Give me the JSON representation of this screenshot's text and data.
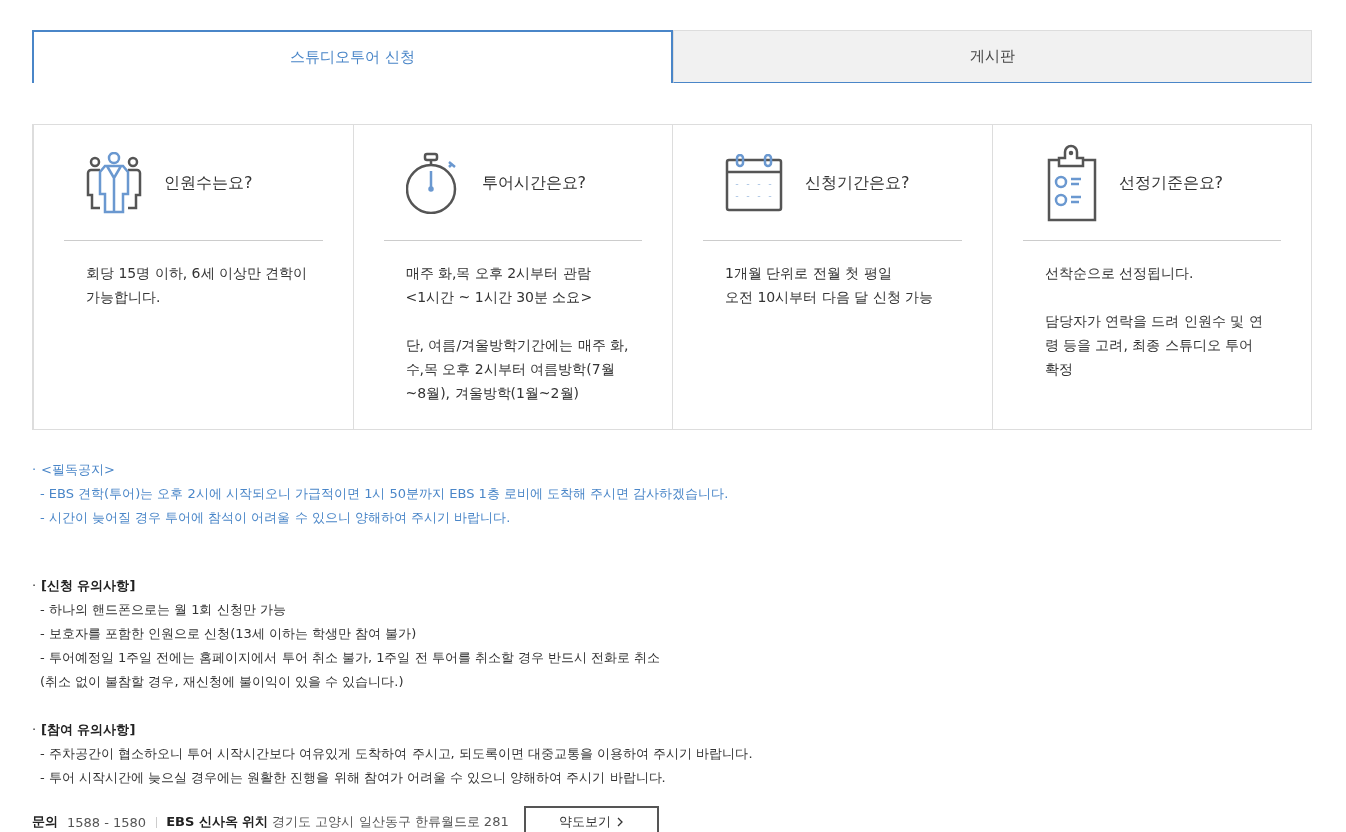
{
  "tabs": [
    {
      "label": "스튜디오투어 신청",
      "selected": true
    },
    {
      "label": "게시판",
      "selected": false
    }
  ],
  "cards": [
    {
      "kind": "people",
      "title": "인원수는요?",
      "paragraphs": [
        [
          "회당 15명 이하, 6세 이상만 견학이 가능합니다."
        ]
      ]
    },
    {
      "kind": "stopwatch",
      "title": "투어시간은요?",
      "paragraphs": [
        [
          "매주 화,목 오후 2시부터 관람",
          "<1시간 ~ 1시간 30분 소요>"
        ],
        [
          "단, 여름/겨울방학기간에는 매주 화,수,목 오후 2시부터 여름방학(7월~8월), 겨울방학(1월~2월)"
        ]
      ]
    },
    {
      "kind": "calendar",
      "title": "신청기간은요?",
      "paragraphs": [
        [
          "1개월 단위로 전월 첫 평일",
          "오전 10시부터 다음 달 신청 가능"
        ]
      ]
    },
    {
      "kind": "clipboard",
      "title": "선정기준은요?",
      "paragraphs": [
        [
          "선착순으로 선정됩니다."
        ],
        [
          "담당자가 연락을 드려 인원수 및 연령 등을 고려, 최종 스튜디오 투어 확정"
        ]
      ]
    }
  ],
  "notices": [
    {
      "kind": "notice",
      "bullet": "·",
      "heading": "<필독공지>",
      "lines": [
        "- EBS 견학(투어)는 오후 2시에 시작되오니 가급적이면 1시 50분까지 EBS 1층 로비에 도착해 주시면 감사하겠습니다.",
        "- 시간이 늦어질 경우 투어에 참석이 어려울 수 있으니 양해하여 주시기 바랍니다."
      ]
    },
    {
      "kind": "rule",
      "bullet": "·",
      "heading": "[신청 유의사항]",
      "lines": [
        "- 하나의 핸드폰으로는 월 1회 신청만 가능",
        "- 보호자를 포함한 인원으로 신청(13세 이하는 학생만 참여 불가)",
        "- 투어예정일 1주일 전에는 홈페이지에서 투어 취소 불가, 1주일 전 투어를 취소할 경우 반드시 전화로 취소",
        "(취소 없이 불참할 경우, 재신청에 불이익이 있을 수 있습니다.)"
      ]
    },
    {
      "kind": "rule",
      "bullet": "·",
      "heading": "[참여 유의사항]",
      "lines": [
        "- 주차공간이 협소하오니 투어 시작시간보다 여유있게 도착하여 주시고, 되도록이면 대중교통을 이용하여 주시기 바랍니다.",
        "- 투어 시작시간에 늦으실 경우에는 원활한 진행을 위해 참여가 어려울 수 있으니 양해하여 주시기 바랍니다."
      ]
    }
  ],
  "footer": {
    "contact_label": "문의",
    "phone": "1588 - 1580",
    "location_label": "EBS 신사옥 위치",
    "address": "경기도 고양시 일산동구 한류월드로 281",
    "map_button": "약도보기"
  }
}
